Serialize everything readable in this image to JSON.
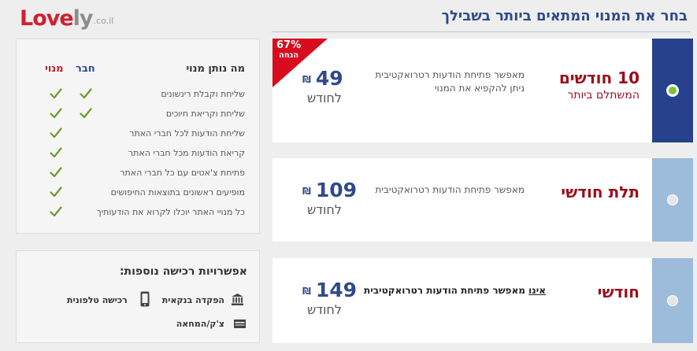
{
  "logo": {
    "part1": "Love",
    "part2": "ly",
    "suffix": ".co.il"
  },
  "page_title": "בחר את המנוי המתאים ביותר בשבילך",
  "plans": [
    {
      "name": "10 חודשים",
      "subtitle": "המשתלם ביותר",
      "desc_line1": "מאפשר פתיחת הודעות רטרואקטיבית",
      "desc_line2": "ניתן להקפיא את המנוי",
      "price": "49",
      "currency": "₪",
      "per_month": "לחודש",
      "discount_pct": "67%",
      "discount_label": "הנחה",
      "selected": true
    },
    {
      "name": "תלת חודשי",
      "desc_line1": "מאפשר פתיחת הודעות רטרואקטיבית",
      "price": "109",
      "currency": "₪",
      "per_month": "לחודש",
      "selected": false
    },
    {
      "name": "חודשי",
      "desc_not": "אינו",
      "desc_rest": "מאפשר פתיחת הודעות רטרואקטיבית",
      "price": "149",
      "currency": "₪",
      "per_month": "לחודש",
      "selected": false
    }
  ],
  "features_panel": {
    "header_what": "מה נותן מנוי",
    "header_member": "חבר",
    "header_subscriber": "מנוי",
    "rows": [
      {
        "label": "שליחת וקבלת רינשונים",
        "member": true,
        "subscriber": true
      },
      {
        "label": "שליחת וקריאת חיוכים",
        "member": true,
        "subscriber": true
      },
      {
        "label": "שליחת הודעות לכל חברי האתר",
        "member": false,
        "subscriber": true
      },
      {
        "label": "קריאת הודעות מכל חברי האתר",
        "member": false,
        "subscriber": true
      },
      {
        "label": "פתיחת צ'אטים עם כל חברי האתר",
        "member": false,
        "subscriber": true
      },
      {
        "label": "מופיעים ראשונים בתוצאות החיפושים",
        "member": false,
        "subscriber": true
      },
      {
        "label": "כל מנויי האתר יוכלו לקרוא את הודעותיך",
        "member": false,
        "subscriber": true
      }
    ]
  },
  "purchase_panel": {
    "title": "אפשרויות רכישה נוספות:",
    "bank": "הפקדה בנקאית",
    "phone": "רכישה טלפונית",
    "check": "צ'ק/המחאה"
  },
  "colors": {
    "brand_red": "#d1202f",
    "title_blue": "#2f4a8a",
    "selected_bar": "#27418c",
    "unselected_bar": "#9dbcdc",
    "check_green": "#6a9a2c"
  }
}
